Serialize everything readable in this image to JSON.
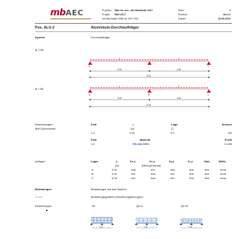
{
  "header": {
    "logo_main": "mb",
    "logo_accent": "AEC",
    "left_labels": [
      "Proj.Bez.",
      "Projekt",
      "mb BauStatik S355.de 2017.000"
    ],
    "project_name": "Was ist neu - mb Workbutz 2017",
    "project": "WIN 2017",
    "right_labels": [
      "Seite",
      "Position",
      "Datum"
    ],
    "right_values": [
      "1",
      "ALU-2",
      "19.09.2016"
    ]
  },
  "title": {
    "pos": "Pos. ALU-2",
    "name": "Aluminium-Durchlaufträger"
  },
  "system": {
    "label": "System",
    "value": "Durchlaufträger",
    "scale_label": "M 1:55",
    "dim1": "3.00",
    "dim2": "3.00",
    "dim_total": "6.00",
    "supports": [
      "A",
      "B",
      "C"
    ],
    "fields": [
      "1",
      "2"
    ]
  },
  "system2": {
    "scale_label": "M 1:55",
    "dim1": "3.00",
    "dim2": "3.00",
    "dim_total": "6.00",
    "supports": [
      "A",
      "B",
      "C"
    ],
    "fields": [
      "1",
      "2"
    ]
  },
  "abmessungen": {
    "label1": "Abmessungen",
    "label2": "Mat./Querschnitt",
    "headers": [
      "Feld",
      "l",
      "Lage",
      "Achsen"
    ],
    "units": [
      "",
      "[m]",
      "[°]",
      ""
    ],
    "row": [
      "1-2",
      "3.00",
      "0.0",
      "frei"
    ],
    "headers2": [
      "Feld",
      "Material",
      "Profil"
    ],
    "row2": [
      "1-2",
      "EN-AW-5454",
      "U 100"
    ]
  },
  "auflager": {
    "label": "Auflager",
    "headers": [
      "Lager",
      "x",
      "Kᴛ,z",
      "Kᴛ,z",
      "Kᵣ,y",
      "Kᵣ,z",
      "Gab.",
      "Wölb."
    ],
    "units_x": "[m]",
    "units_k": "[kN/m],[kNm/rad]",
    "rows": [
      [
        "A",
        "0.00",
        "fest",
        "frei",
        "fest",
        "fest",
        "fest",
        "ohne"
      ],
      [
        "B",
        "3.00",
        "frei",
        "fest",
        "frei",
        "fest",
        "fest",
        "ohne"
      ],
      [
        "C",
        "6.00",
        "frei",
        "fest",
        "frei",
        "fest",
        "fest",
        "ohne"
      ]
    ]
  },
  "belastungen": {
    "label": "Belastungen",
    "value": "Belastungen auf das System",
    "grafik_label": "Grafik",
    "grafik_value": "Belastungsgrafiken (Einwirkungsbezogen)",
    "einw_label": "Einwirkungen",
    "cases": [
      "Gk",
      "Qk.N",
      "Qk.W"
    ],
    "case_dims": [
      "1.00",
      "1.00",
      "6.00"
    ]
  },
  "colors": {
    "beam_red": "#c8102e",
    "support_red": "#d01030",
    "dim_blue": "#1f5fa8",
    "logo_red": "#b5002e"
  }
}
